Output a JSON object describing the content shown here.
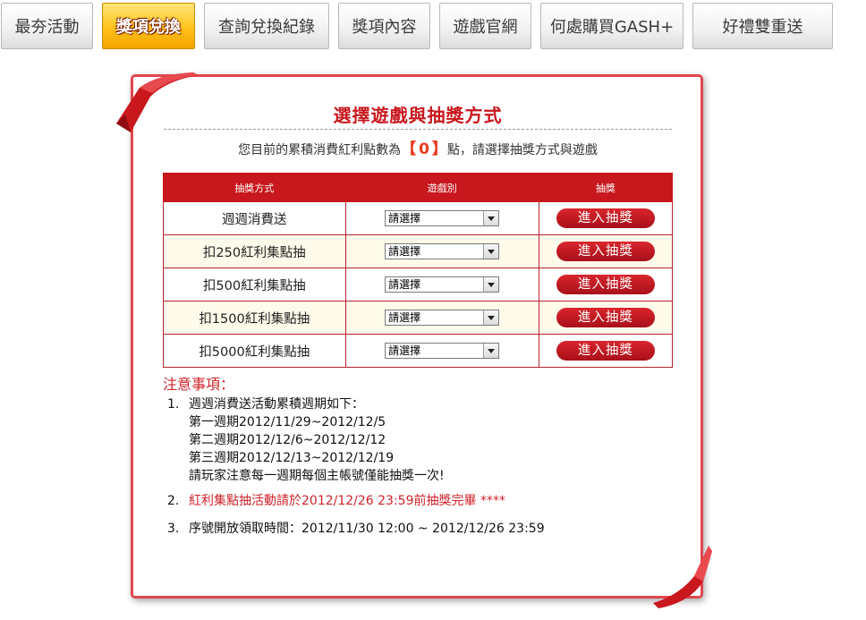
{
  "tabs": [
    {
      "label": "最夯活動",
      "active": false
    },
    {
      "label": "獎項兌換",
      "active": true
    },
    {
      "label": "查詢兌換紀錄",
      "active": false
    },
    {
      "label": "獎項內容",
      "active": false
    },
    {
      "label": "遊戲官網",
      "active": false
    },
    {
      "label": "何處購買GASH+",
      "active": false
    },
    {
      "label": "好禮雙重送",
      "active": false
    }
  ],
  "panel": {
    "title": "選擇遊戲與抽獎方式",
    "points_prefix": "您目前的累積消費紅利點數為",
    "points_open": "【",
    "points_value": "0",
    "points_close": "】",
    "points_suffix": "點，請選擇抽獎方式與遊戲"
  },
  "table": {
    "headers": [
      "抽獎方式",
      "遊戲別",
      "抽獎"
    ],
    "rows": [
      {
        "method": "週週消費送",
        "select": "請選擇",
        "button": "進入抽獎"
      },
      {
        "method": "扣250紅利集點抽",
        "select": "請選擇",
        "button": "進入抽獎"
      },
      {
        "method": "扣500紅利集點抽",
        "select": "請選擇",
        "button": "進入抽獎"
      },
      {
        "method": "扣1500紅利集點抽",
        "select": "請選擇",
        "button": "進入抽獎"
      },
      {
        "method": "扣5000紅利集點抽",
        "select": "請選擇",
        "button": "進入抽獎"
      }
    ]
  },
  "notes": {
    "title": "注意事項：",
    "items": [
      {
        "num": "1.",
        "lines": [
          "週週消費送活動累積週期如下：",
          "第一週期2012/11/29~2012/12/5",
          "第二週期2012/12/6~2012/12/12",
          "第三週期2012/12/13~2012/12/19",
          "請玩家注意每一週期每個主帳號僅能抽獎一次!"
        ]
      },
      {
        "num": "2.",
        "text": "紅利集點抽活動請於2012/12/26 23:59前抽獎完畢 ****"
      },
      {
        "num": "3.",
        "text": "序號開放領取時間：2012/11/30 12:00 ~ 2012/12/26 23:59"
      }
    ]
  },
  "colors": {
    "accent": "#c8171d",
    "tab_active": "#ffc21a",
    "note_red": "#d0232a"
  }
}
